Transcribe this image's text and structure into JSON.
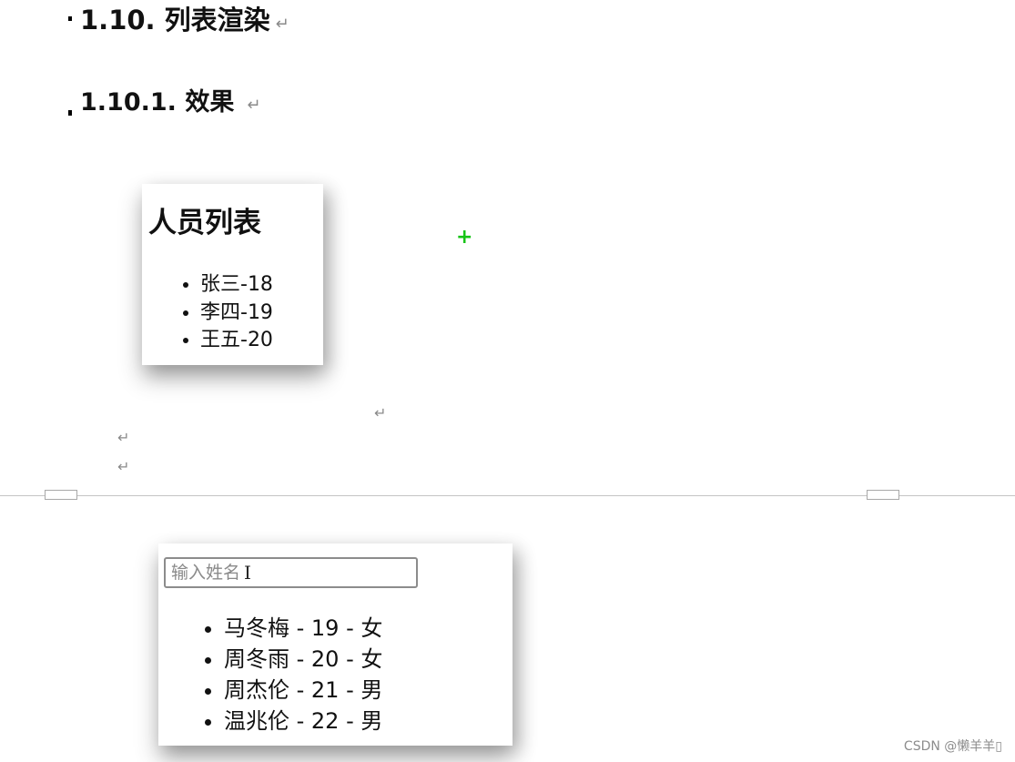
{
  "doc": {
    "heading1": "1.10. 列表渲染",
    "heading2": "1.10.1. 效果",
    "paragraph_mark": "↵"
  },
  "demo1": {
    "title": "人员列表",
    "items": [
      "张三-18",
      "李四-19",
      "王五-20"
    ]
  },
  "demo2": {
    "input_placeholder": "输入姓名",
    "items": [
      "马冬梅 - 19 - 女",
      "周冬雨 - 20 - 女",
      "周杰伦 - 21 - 男",
      "温兆伦 - 22 - 男"
    ]
  },
  "overlay": {
    "plus_marker": "+",
    "cursor_glyph": "I"
  },
  "watermark": "CSDN @懒羊羊▯",
  "colors": {
    "accent_plus": "#16c416",
    "paragraph_mark": "#8a8a8a"
  }
}
